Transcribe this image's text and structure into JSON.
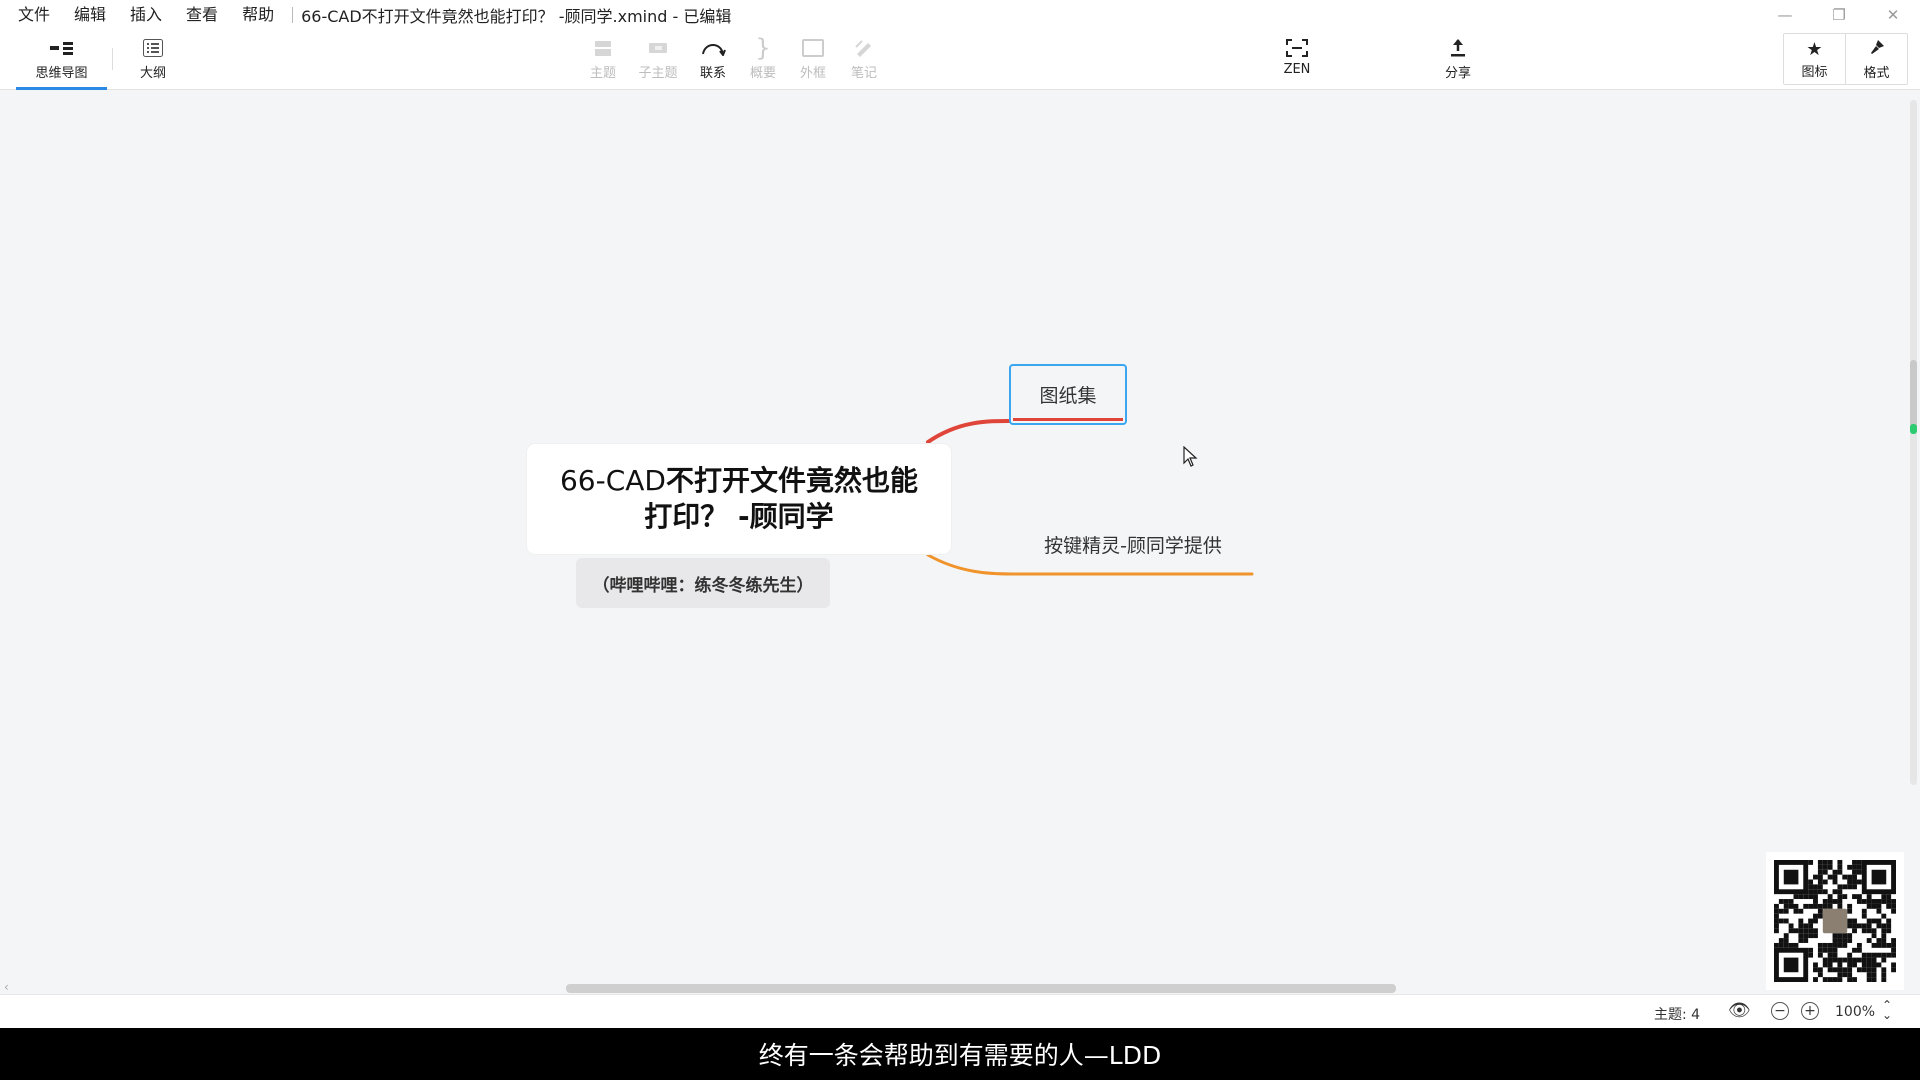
{
  "menu": [
    "文件",
    "编辑",
    "插入",
    "查看",
    "帮助"
  ],
  "window_title": "66-CAD不打开文件竟然也能打印？ -顾同学.xmind - 已编辑",
  "toolbar": {
    "mindmap": "思维导图",
    "outline": "大纲",
    "topic": "主题",
    "subtopic": "子主题",
    "relationship": "联系",
    "summary": "概要",
    "boundary": "外框",
    "note": "笔记",
    "zen": "ZEN",
    "share": "分享",
    "icons": "图标",
    "format": "格式"
  },
  "map": {
    "central_line1_light": "66-CAD",
    "central_line1_bold": "不打开文件竟然也能",
    "central_line2": "打印？ -顾同学",
    "floating_note": "（哔哩哔哩：练冬冬练先生）",
    "topic1": "图纸集",
    "topic2": "按键精灵-顾同学提供",
    "link_colors": [
      "#e0453a",
      "#f0932b"
    ],
    "selection_color": "#3aa6f0"
  },
  "status": {
    "topics": "主题: 4",
    "zoom": "100%"
  },
  "subtitle": "终有一条会帮助到有需要的人—LDD"
}
